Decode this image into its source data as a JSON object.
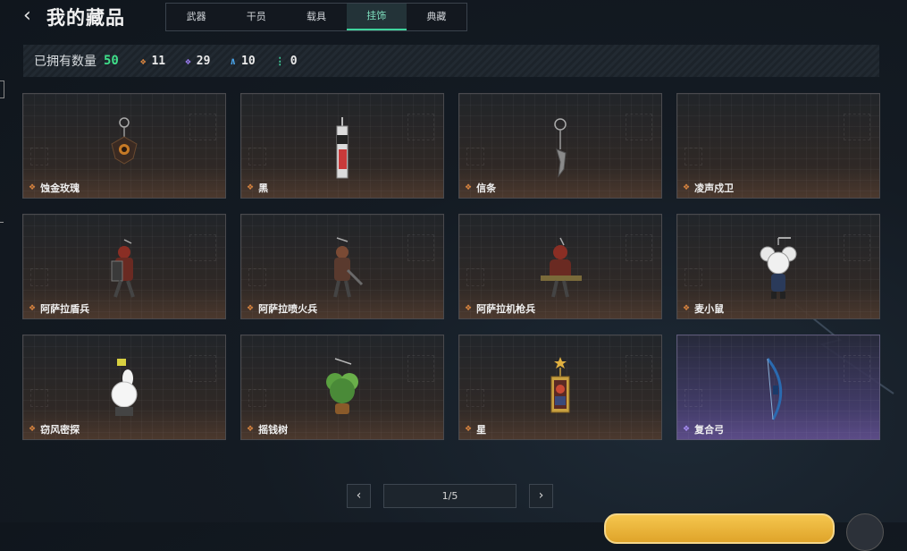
{
  "header": {
    "title": "我的藏品",
    "tabs": [
      {
        "label": "武器",
        "active": false
      },
      {
        "label": "干员",
        "active": false
      },
      {
        "label": "载具",
        "active": false
      },
      {
        "label": "挂饰",
        "active": true
      },
      {
        "label": "典藏",
        "active": false
      }
    ]
  },
  "stats": {
    "owned_label": "已拥有数量",
    "owned_value": "50",
    "counts": [
      {
        "icon": "orange-diamond-icon",
        "value": "11",
        "color": "#d8843f"
      },
      {
        "icon": "purple-diamond-icon",
        "value": "29",
        "color": "#9b7cf0"
      },
      {
        "icon": "blue-chevron-icon",
        "value": "10",
        "color": "#4aa3e8"
      },
      {
        "icon": "green-dots-icon",
        "value": "0",
        "color": "#3fd49d"
      }
    ]
  },
  "items": [
    {
      "name": "蚀金玫瑰",
      "rarity": "orange"
    },
    {
      "name": "黑",
      "rarity": "orange"
    },
    {
      "name": "信条",
      "rarity": "orange"
    },
    {
      "name": "凌声戍卫",
      "rarity": "orange"
    },
    {
      "name": "阿萨拉盾兵",
      "rarity": "orange"
    },
    {
      "name": "阿萨拉喷火兵",
      "rarity": "orange"
    },
    {
      "name": "阿萨拉机枪兵",
      "rarity": "orange"
    },
    {
      "name": "麦小鼠",
      "rarity": "orange"
    },
    {
      "name": "窃风密探",
      "rarity": "orange"
    },
    {
      "name": "摇钱树",
      "rarity": "orange"
    },
    {
      "name": "星",
      "rarity": "orange"
    },
    {
      "name": "复合弓",
      "rarity": "purple"
    }
  ],
  "pagination": {
    "indicator": "1/5",
    "prev": "‹",
    "next": "›"
  },
  "colors": {
    "accent_green": "#3fd49d",
    "owned_green": "#3fe08a",
    "rarity_orange": "#d8843f",
    "rarity_purple": "#a58cf0"
  }
}
